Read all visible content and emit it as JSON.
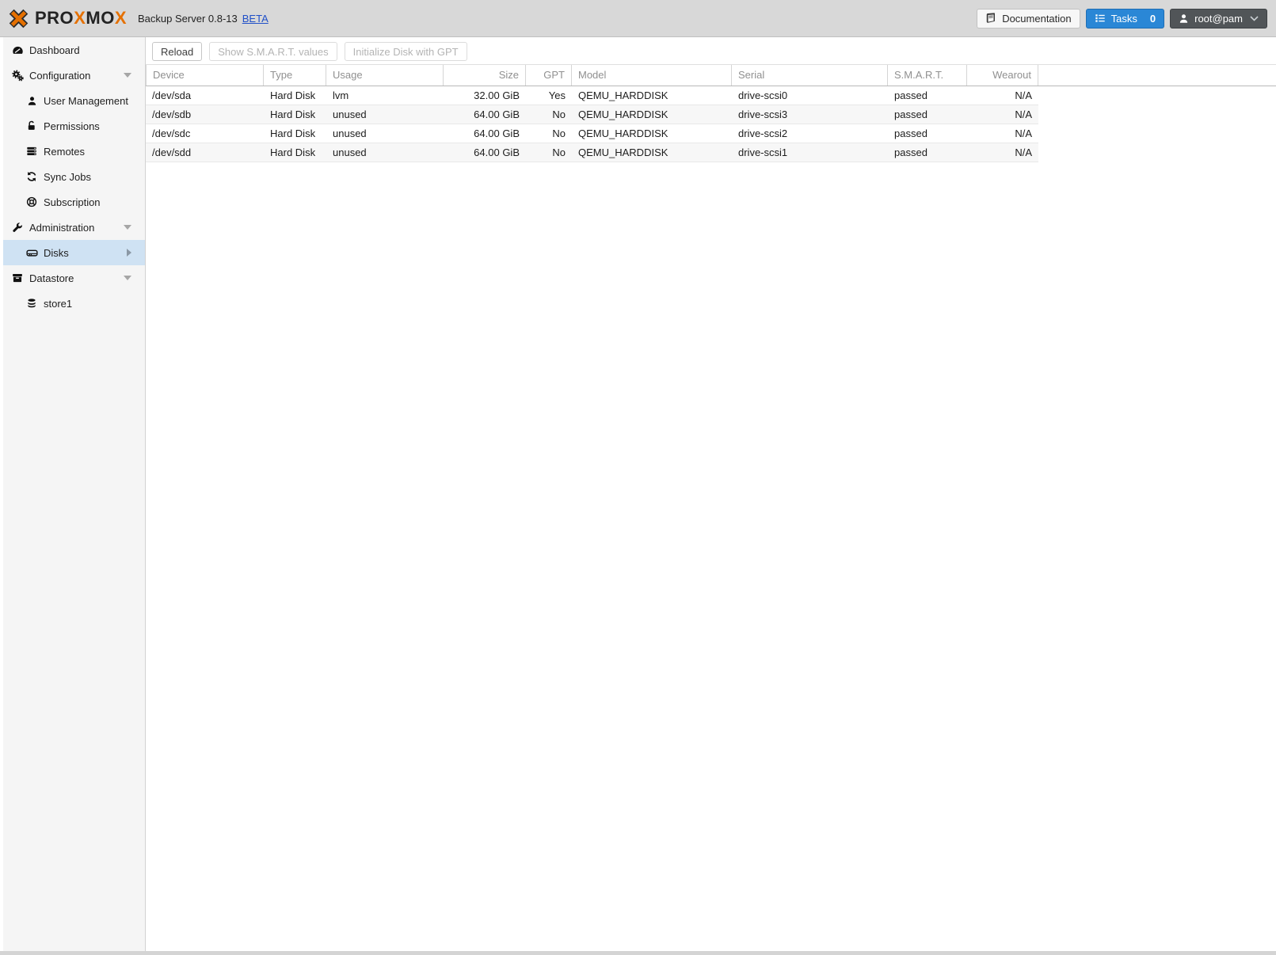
{
  "header": {
    "logo_segments": [
      {
        "text": "PRO",
        "accent": false
      },
      {
        "text": "X",
        "accent": true
      },
      {
        "text": "MO",
        "accent": false
      },
      {
        "text": "X",
        "accent": true
      }
    ],
    "title": "Backup Server 0.8-13",
    "beta_label": "BETA",
    "documentation_label": "Documentation",
    "tasks_label": "Tasks",
    "tasks_count": "0",
    "user_label": "root@pam"
  },
  "sidebar": {
    "items": [
      {
        "label": "Dashboard",
        "icon": "dashboard-icon",
        "level": 0,
        "expandable": false,
        "selected": false
      },
      {
        "label": "Configuration",
        "icon": "gears-icon",
        "level": 0,
        "expandable": true,
        "selected": false
      },
      {
        "label": "User Management",
        "icon": "user-icon",
        "level": 1,
        "expandable": false,
        "selected": false
      },
      {
        "label": "Permissions",
        "icon": "unlock-icon",
        "level": 1,
        "expandable": false,
        "selected": false
      },
      {
        "label": "Remotes",
        "icon": "server-icon",
        "level": 1,
        "expandable": false,
        "selected": false
      },
      {
        "label": "Sync Jobs",
        "icon": "sync-icon",
        "level": 1,
        "expandable": false,
        "selected": false
      },
      {
        "label": "Subscription",
        "icon": "lifering-icon",
        "level": 1,
        "expandable": false,
        "selected": false
      },
      {
        "label": "Administration",
        "icon": "wrench-icon",
        "level": 0,
        "expandable": true,
        "selected": false
      },
      {
        "label": "Disks",
        "icon": "hdd-icon",
        "level": 1,
        "expandable": false,
        "selected": true
      },
      {
        "label": "Datastore",
        "icon": "archive-icon",
        "level": 0,
        "expandable": true,
        "selected": false
      },
      {
        "label": "store1",
        "icon": "database-icon",
        "level": 1,
        "expandable": false,
        "selected": false
      }
    ]
  },
  "toolbar": {
    "reload_label": "Reload",
    "smart_label": "Show S.M.A.R.T. values",
    "gpt_label": "Initialize Disk with GPT"
  },
  "table": {
    "columns": [
      {
        "label": "Device",
        "align": "left"
      },
      {
        "label": "Type",
        "align": "left"
      },
      {
        "label": "Usage",
        "align": "left"
      },
      {
        "label": "Size",
        "align": "right"
      },
      {
        "label": "GPT",
        "align": "right"
      },
      {
        "label": "Model",
        "align": "left"
      },
      {
        "label": "Serial",
        "align": "left"
      },
      {
        "label": "S.M.A.R.T.",
        "align": "left"
      },
      {
        "label": "Wearout",
        "align": "right"
      }
    ],
    "rows": [
      [
        "/dev/sda",
        "Hard Disk",
        "lvm",
        "32.00 GiB",
        "Yes",
        "QEMU_HARDDISK",
        "drive-scsi0",
        "passed",
        "N/A"
      ],
      [
        "/dev/sdb",
        "Hard Disk",
        "unused",
        "64.00 GiB",
        "No",
        "QEMU_HARDDISK",
        "drive-scsi3",
        "passed",
        "N/A"
      ],
      [
        "/dev/sdc",
        "Hard Disk",
        "unused",
        "64.00 GiB",
        "No",
        "QEMU_HARDDISK",
        "drive-scsi2",
        "passed",
        "N/A"
      ],
      [
        "/dev/sdd",
        "Hard Disk",
        "unused",
        "64.00 GiB",
        "No",
        "QEMU_HARDDISK",
        "drive-scsi1",
        "passed",
        "N/A"
      ]
    ]
  },
  "colors": {
    "brand_orange": "#e57000",
    "accent_blue": "#2a87d6",
    "selected_item_blue": "#cfe2f3",
    "link_blue": "#2050c8",
    "topbar_gray": "#d8d8d8",
    "sidebar_gray": "#f5f5f5",
    "smart_status": "passed"
  }
}
